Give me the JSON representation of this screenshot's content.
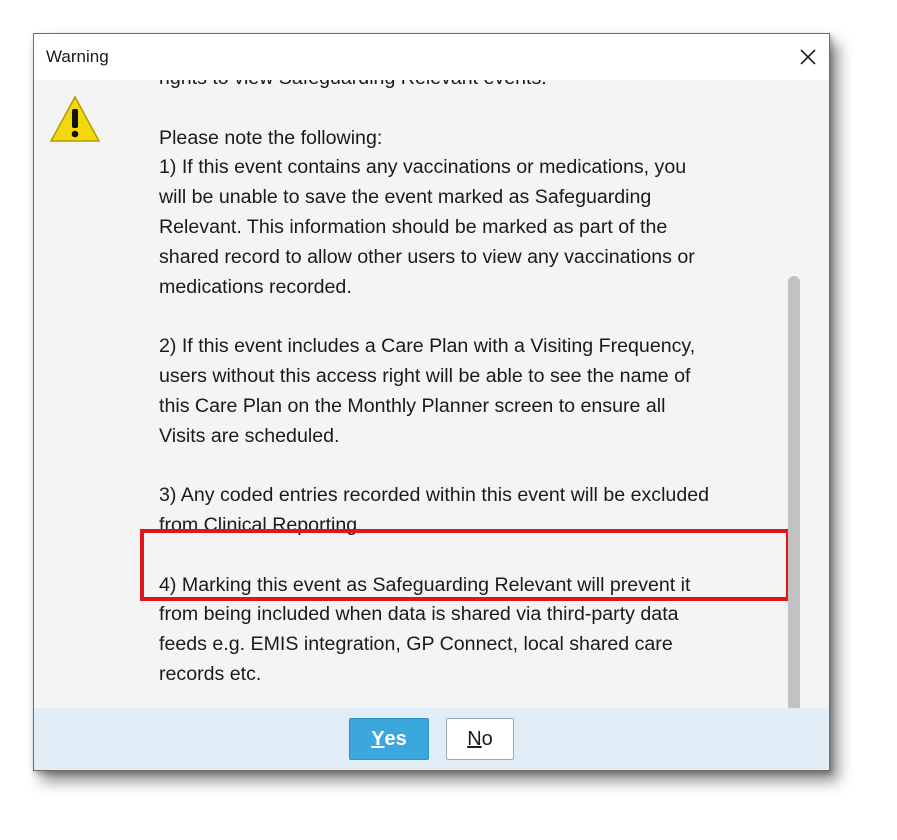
{
  "dialog": {
    "title": "Warning",
    "close_icon": "close-icon",
    "warning_icon": "warning-triangle-icon"
  },
  "content": {
    "cut_line": "rights to view Safeguarding Relevant events.",
    "intro": "Please note the following:",
    "paragraphs": [
      {
        "lines": [
          "1) If this event contains any vaccinations or medications, you",
          "will be unable to save the event marked as Safeguarding",
          "Relevant. This information should be marked as part of the",
          "shared record to allow other users to view any vaccinations or",
          "medications recorded."
        ]
      },
      {
        "lines": [
          "2) If this event includes a Care Plan with a Visiting Frequency,",
          "users without this access right will be able to see the name of",
          "this Care Plan on the Monthly Planner screen to ensure all",
          "Visits are scheduled."
        ]
      },
      {
        "lines": [
          "3) Any coded entries recorded within this event will be excluded",
          "from Clinical Reporting."
        ]
      },
      {
        "lines": [
          "4) Marking this event as Safeguarding Relevant will prevent it",
          "from being included when data is shared via third-party data",
          "feeds e.g. EMIS integration, GP Connect, local shared care",
          "records etc."
        ]
      }
    ]
  },
  "buttons": {
    "yes_first": "Y",
    "yes_rest": "es",
    "no_first": "N",
    "no_rest": "o"
  },
  "colors": {
    "highlight": "#e0161e",
    "yes_button": "#3ba7dd",
    "footer": "#e1eef8",
    "warning_yellow": "#f2d80c"
  }
}
